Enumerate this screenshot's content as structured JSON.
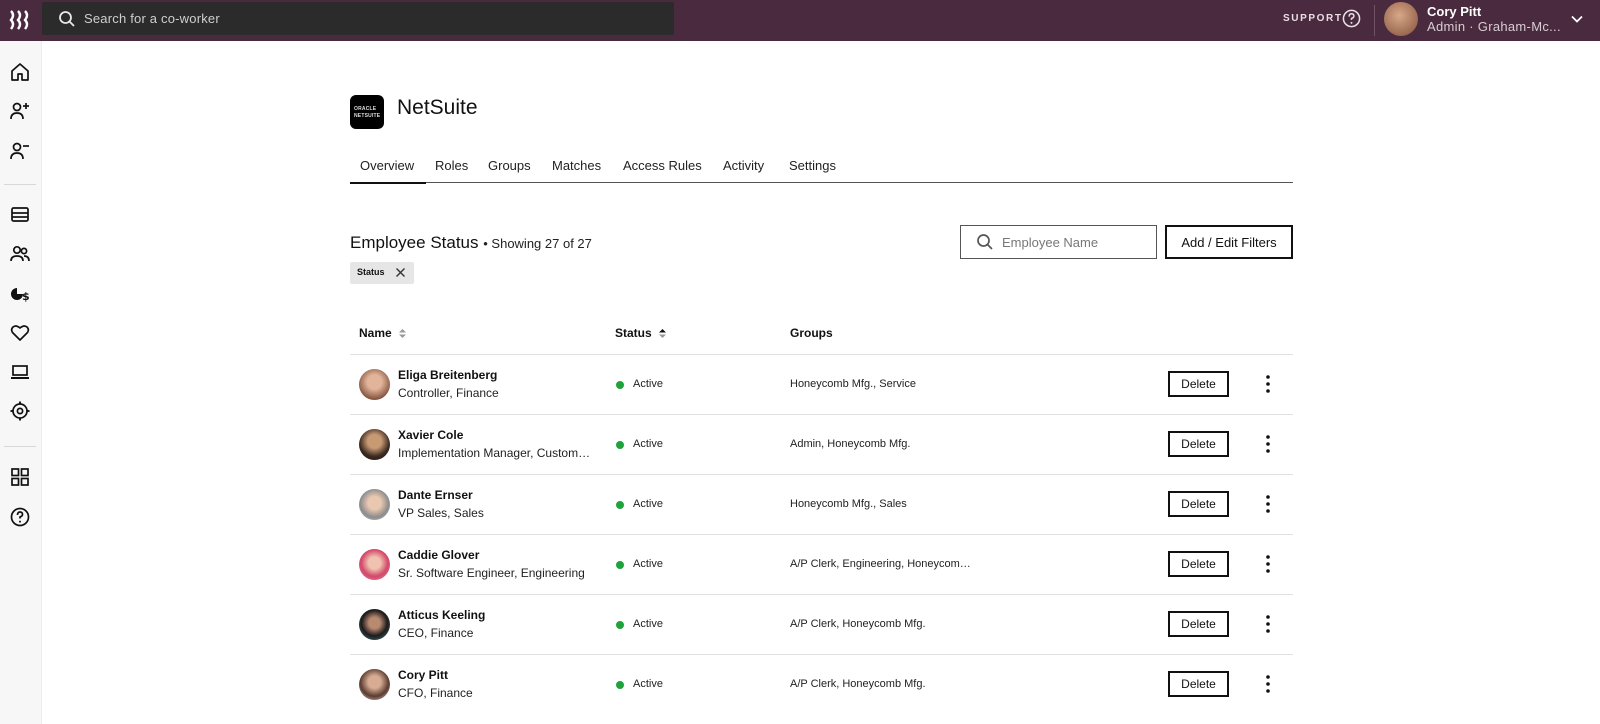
{
  "topbar": {
    "search_placeholder": "Search for a co-worker",
    "support_label": "SUPPORT",
    "user": {
      "name": "Cory Pitt",
      "role": "Admin · Graham-Mc..."
    }
  },
  "sidebar": {
    "items": [
      "home-icon",
      "user-add-icon",
      "user-remove-icon",
      "inventory-icon",
      "team-icon",
      "payroll-icon",
      "benefits-icon",
      "device-icon",
      "settings-icon",
      "apps-grid-icon",
      "help-icon"
    ]
  },
  "app": {
    "name": "NetSuite",
    "logo_text": [
      "ORACLE",
      "NETSUITE"
    ]
  },
  "tabs": [
    {
      "label": "Overview",
      "active": true
    },
    {
      "label": "Roles",
      "active": false
    },
    {
      "label": "Groups",
      "active": false
    },
    {
      "label": "Matches",
      "active": false
    },
    {
      "label": "Access Rules",
      "active": false
    },
    {
      "label": "Activity",
      "active": false
    },
    {
      "label": "Settings",
      "active": false
    }
  ],
  "section": {
    "title": "Employee Status",
    "count_text": "• Showing 27 of 27",
    "chip_label": "Status",
    "search_placeholder": "Employee Name",
    "filter_button": "Add / Edit Filters"
  },
  "table": {
    "columns": {
      "name": "Name",
      "status": "Status",
      "groups": "Groups"
    },
    "delete_label": "Delete",
    "rows": [
      {
        "name": "Eliga Breitenberg",
        "title": "Controller, Finance",
        "status": "Active",
        "groups": "Honeycomb Mfg., Service"
      },
      {
        "name": "Xavier Cole",
        "title": "Implementation Manager, Customer Success",
        "status": "Active",
        "groups": "Admin, Honeycomb Mfg."
      },
      {
        "name": "Dante Ernser",
        "title": "VP Sales, Sales",
        "status": "Active",
        "groups": "Honeycomb Mfg., Sales"
      },
      {
        "name": "Caddie Glover",
        "title": "Sr. Software Engineer, Engineering",
        "status": "Active",
        "groups": "A/P Clerk, Engineering, Honeycomb Mfg."
      },
      {
        "name": "Atticus Keeling",
        "title": "CEO, Finance",
        "status": "Active",
        "groups": "A/P Clerk, Honeycomb Mfg."
      },
      {
        "name": "Cory Pitt",
        "title": "CFO, Finance",
        "status": "Active",
        "groups": "A/P Clerk, Honeycomb Mfg."
      }
    ]
  },
  "colors": {
    "topbar": "#4a2a3e",
    "status_active": "#1fa33a",
    "search_bg": "#2b2b2b"
  }
}
